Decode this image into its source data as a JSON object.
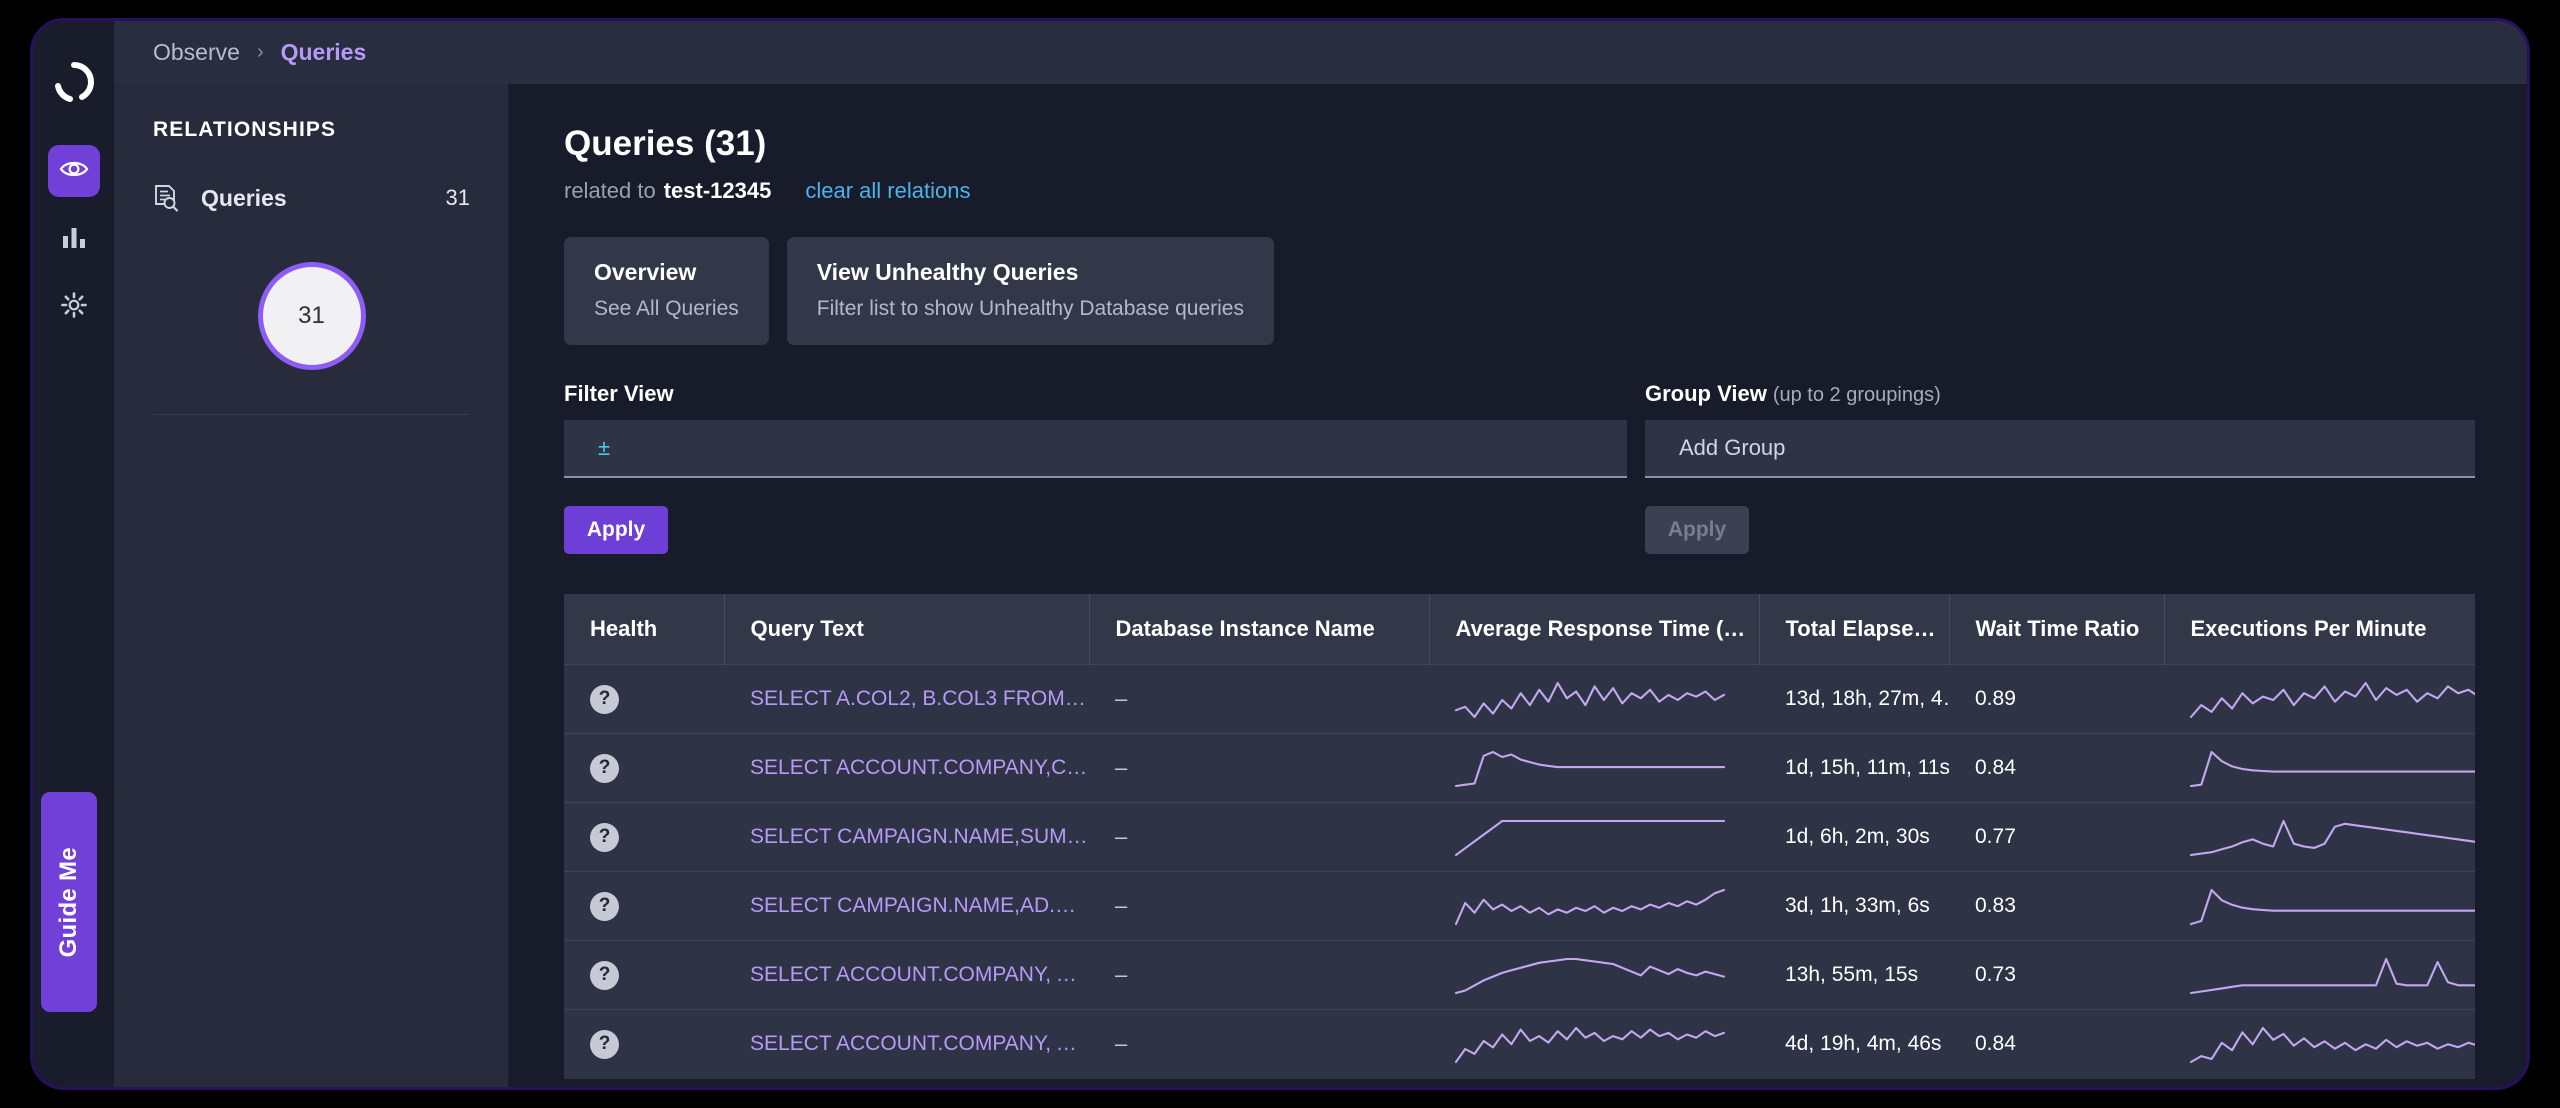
{
  "breadcrumb": {
    "root": "Observe",
    "separator": "›",
    "current": "Queries"
  },
  "rail": {
    "logo_icon": "swoosh-logo-icon",
    "items": [
      {
        "icon": "eye-icon",
        "name": "observe",
        "active": true
      },
      {
        "icon": "bar-chart-icon",
        "name": "metrics",
        "active": false
      },
      {
        "icon": "gear-icon",
        "name": "settings",
        "active": false
      }
    ],
    "guide_me": "Guide Me"
  },
  "relationships": {
    "title": "RELATIONSHIPS",
    "row": {
      "icon": "document-search-icon",
      "label": "Queries",
      "count": "31"
    },
    "circle_value": "31",
    "circle_border_color": "#8b5cf6"
  },
  "main": {
    "title": "Queries (31)",
    "related_prefix": "related to",
    "related_entity": "test-12345",
    "clear_link": "clear all relations",
    "cards": [
      {
        "title": "Overview",
        "subtitle": "See All Queries"
      },
      {
        "title": "View Unhealthy Queries",
        "subtitle": "Filter list to show Unhealthy Database queries"
      }
    ],
    "filter_view": {
      "label": "Filter View",
      "glyph": "±",
      "value": "",
      "placeholder": "",
      "apply_label": "Apply"
    },
    "group_view": {
      "label": "Group View",
      "hint": "(up to 2 groupings)",
      "placeholder": "Add Group",
      "apply_label": "Apply"
    }
  },
  "table": {
    "columns": [
      "Health",
      "Query Text",
      "Database Instance Name",
      "Average Response Time (ms)",
      "Total Elapsed Ti…",
      "Wait Time Ratio",
      "Executions Per Minute"
    ],
    "rows": [
      {
        "health": "?",
        "query_text": "SELECT A.COL2, B.COL3 FROM …",
        "db_instance": "–",
        "avg_response_spark": [
          38,
          42,
          30,
          46,
          34,
          50,
          40,
          58,
          44,
          62,
          48,
          70,
          52,
          60,
          44,
          66,
          50,
          64,
          46,
          58,
          52,
          62,
          48,
          56,
          50,
          58,
          54,
          60,
          50,
          56
        ],
        "total_elapsed": "13d, 18h, 27m, 4…",
        "wait_ratio": "0.89",
        "executions_spark": [
          30,
          44,
          36,
          52,
          40,
          58,
          46,
          54,
          50,
          62,
          44,
          58,
          52,
          66,
          48,
          60,
          54,
          70,
          50,
          64,
          56,
          62,
          48,
          58,
          52,
          66,
          58,
          62,
          54,
          60
        ]
      },
      {
        "health": "?",
        "query_text": "SELECT ACCOUNT.COMPANY,C…",
        "db_instance": "–",
        "avg_response_spark": [
          10,
          12,
          14,
          58,
          64,
          56,
          60,
          52,
          48,
          44,
          42,
          40,
          40,
          40,
          40,
          40,
          40,
          40,
          40,
          40,
          40,
          40,
          40,
          40,
          40,
          40,
          40,
          40,
          40,
          40
        ],
        "total_elapsed": "1d, 15h, 11m, 11s",
        "wait_ratio": "0.84",
        "executions_spark": [
          8,
          10,
          60,
          46,
          38,
          34,
          32,
          31,
          30,
          30,
          30,
          30,
          30,
          30,
          30,
          30,
          30,
          30,
          30,
          30,
          30,
          30,
          30,
          30,
          30,
          30,
          30,
          30,
          30,
          30
        ]
      },
      {
        "health": "?",
        "query_text": "SELECT CAMPAIGN.NAME,SUM…",
        "db_instance": "–",
        "avg_response_spark": [
          34,
          36,
          38,
          40,
          42,
          44,
          44,
          44,
          44,
          44,
          44,
          44,
          44,
          44,
          44,
          44,
          44,
          44,
          44,
          44,
          44,
          44,
          44,
          44,
          44,
          44,
          44,
          44,
          44,
          44
        ],
        "total_elapsed": "1d, 6h, 2m, 30s",
        "wait_ratio": "0.77",
        "executions_spark": [
          18,
          20,
          22,
          26,
          30,
          36,
          40,
          34,
          30,
          66,
          34,
          30,
          28,
          34,
          58,
          62,
          60,
          58,
          56,
          54,
          52,
          50,
          48,
          46,
          44,
          42,
          40,
          38,
          36,
          34
        ]
      },
      {
        "health": "?",
        "query_text": "SELECT CAMPAIGN.NAME,AD.N…",
        "db_instance": "–",
        "avg_response_spark": [
          20,
          46,
          34,
          50,
          38,
          44,
          36,
          42,
          34,
          40,
          32,
          38,
          34,
          40,
          36,
          42,
          34,
          40,
          36,
          42,
          38,
          44,
          40,
          46,
          42,
          48,
          44,
          50,
          58,
          62
        ],
        "total_elapsed": "3d, 1h, 33m, 6s",
        "wait_ratio": "0.83",
        "executions_spark": [
          8,
          12,
          54,
          40,
          34,
          30,
          28,
          27,
          26,
          26,
          26,
          26,
          26,
          26,
          26,
          26,
          26,
          26,
          26,
          26,
          26,
          26,
          26,
          26,
          26,
          26,
          26,
          26,
          26,
          26
        ]
      },
      {
        "health": "?",
        "query_text": "SELECT ACCOUNT.COMPANY, A…",
        "db_instance": "–",
        "avg_response_spark": [
          10,
          14,
          22,
          30,
          36,
          42,
          46,
          50,
          54,
          58,
          60,
          62,
          64,
          64,
          62,
          60,
          58,
          56,
          50,
          44,
          38,
          52,
          46,
          40,
          48,
          42,
          38,
          44,
          40,
          36
        ],
        "total_elapsed": "13h, 55m, 15s",
        "wait_ratio": "0.73",
        "executions_spark": [
          12,
          14,
          16,
          18,
          20,
          22,
          22,
          22,
          22,
          22,
          22,
          22,
          22,
          22,
          22,
          22,
          22,
          22,
          22,
          56,
          24,
          22,
          22,
          22,
          52,
          26,
          22,
          22,
          22,
          22
        ]
      },
      {
        "health": "?",
        "query_text": "SELECT ACCOUNT.COMPANY, A…",
        "db_instance": "–",
        "avg_response_spark": [
          18,
          34,
          28,
          44,
          36,
          52,
          40,
          58,
          44,
          50,
          42,
          56,
          46,
          60,
          48,
          54,
          44,
          50,
          46,
          56,
          48,
          58,
          50,
          54,
          46,
          52,
          48,
          56,
          50,
          54
        ],
        "total_elapsed": "4d, 19h, 4m, 46s",
        "wait_ratio": "0.84",
        "executions_spark": [
          14,
          22,
          18,
          40,
          30,
          54,
          38,
          60,
          44,
          52,
          36,
          46,
          34,
          42,
          32,
          40,
          30,
          38,
          32,
          44,
          34,
          42,
          36,
          40,
          32,
          38,
          34,
          40,
          36,
          42
        ]
      }
    ]
  }
}
